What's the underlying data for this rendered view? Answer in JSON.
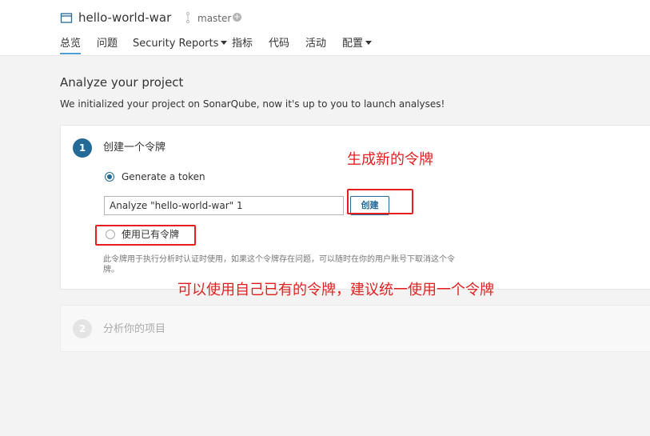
{
  "header": {
    "project_name": "hello-world-war",
    "project_icon": "project-icon",
    "branch_icon": "branch-icon",
    "branch_name": "master",
    "branch_add_symbol": "+"
  },
  "tabs": [
    {
      "label": "总览",
      "active": true
    },
    {
      "label": "问题"
    },
    {
      "label": "Security Reports",
      "dropdown": true
    },
    {
      "label": "指标"
    },
    {
      "label": "代码"
    },
    {
      "label": "活动"
    },
    {
      "label": "配置",
      "dropdown": true
    }
  ],
  "main": {
    "title": "Analyze your project",
    "description": "We initialized your project on SonarQube, now it's up to you to launch analyses!"
  },
  "step1": {
    "number": "1",
    "title": "创建一个令牌",
    "option_generate": "Generate a token",
    "token_value": "Analyze \"hello-world-war\" 1",
    "create_button": "创建",
    "option_existing": "使用已有令牌",
    "help": "此令牌用于执行分析时认证时使用，如果这个令牌存在问题，可以随时在你的用户账号下取消这个令牌。"
  },
  "step2": {
    "number": "2",
    "title": "分析你的项目"
  },
  "annotations": {
    "new_token": "生成新的令牌",
    "existing_token": "可以使用自己已有的令牌，建议统一使用一个令牌",
    "color": "#e51f1f"
  },
  "colors": {
    "accent": "#236a97",
    "tab_underline": "#4b9fd5"
  }
}
